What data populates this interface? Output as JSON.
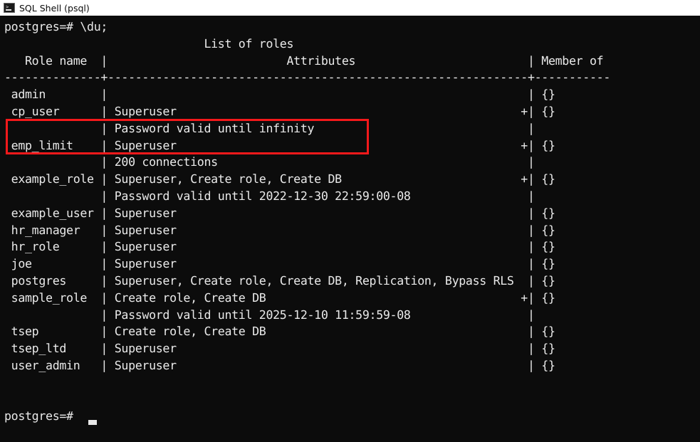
{
  "window": {
    "title": "SQL Shell (psql)",
    "icon": "console-icon",
    "background_color": "#0c0c0c",
    "text_color": "#e9e9e9",
    "titlebar_color": "#ffffff"
  },
  "terminal": {
    "prompt": "postgres=#",
    "command": "\\du;",
    "command_line": "postgres=# \\du;",
    "trailing_prompt": "postgres=#",
    "cursor": "_",
    "report_title": "List of roles",
    "columns": [
      "Role name",
      "Attributes",
      "Member of"
    ],
    "separator_line": "-----------+-------------------------------------------------------------+-----------",
    "rows": [
      {
        "role": "admin",
        "attributes": [
          ""
        ],
        "continued": false,
        "member_of": "{}"
      },
      {
        "role": "cp_user",
        "attributes": [
          "Superuser",
          "Password valid until infinity"
        ],
        "continued": true,
        "member_of": "{}"
      },
      {
        "role": "emp_limit",
        "attributes": [
          "Superuser",
          "200 connections"
        ],
        "continued": true,
        "member_of": "{}"
      },
      {
        "role": "example_role",
        "attributes": [
          "Superuser, Create role, Create DB",
          "Password valid until 2022-12-30 22:59:00-08"
        ],
        "continued": true,
        "member_of": "{}"
      },
      {
        "role": "example_user",
        "attributes": [
          "Superuser"
        ],
        "continued": false,
        "member_of": "{}"
      },
      {
        "role": "hr_manager",
        "attributes": [
          "Superuser"
        ],
        "continued": false,
        "member_of": "{}"
      },
      {
        "role": "hr_role",
        "attributes": [
          "Superuser"
        ],
        "continued": false,
        "member_of": "{}"
      },
      {
        "role": "joe",
        "attributes": [
          "Superuser"
        ],
        "continued": false,
        "member_of": "{}"
      },
      {
        "role": "postgres",
        "attributes": [
          "Superuser, Create role, Create DB, Replication, Bypass RLS"
        ],
        "continued": false,
        "member_of": "{}"
      },
      {
        "role": "sample_role",
        "attributes": [
          "Create role, Create DB",
          "Password valid until 2025-12-10 11:59:59-08"
        ],
        "continued": true,
        "member_of": "{}"
      },
      {
        "role": "tsep",
        "attributes": [
          "Create role, Create DB"
        ],
        "continued": false,
        "member_of": "{}"
      },
      {
        "role": "tsep_ltd",
        "attributes": [
          "Superuser"
        ],
        "continued": false,
        "member_of": "{}"
      },
      {
        "role": "user_admin",
        "attributes": [
          "Superuser"
        ],
        "continued": false,
        "member_of": "{}"
      }
    ],
    "screen_text": "postgres=# \\du;\n                             List of roles\n   Role name  |                          Attributes                         | Member of\n--------------+-------------------------------------------------------------+-----------\n admin        |                                                             | {}\n cp_user      | Superuser                                                  +| {}\n              | Password valid until infinity                               |\n emp_limit    | Superuser                                                  +| {}\n              | 200 connections                                             |\n example_role | Superuser, Create role, Create DB                          +| {}\n              | Password valid until 2022-12-30 22:59:00-08                 |\n example_user | Superuser                                                   | {}\n hr_manager   | Superuser                                                   | {}\n hr_role      | Superuser                                                   | {}\n joe          | Superuser                                                   | {}\n postgres     | Superuser, Create role, Create DB, Replication, Bypass RLS  | {}\n sample_role  | Create role, Create DB                                     +| {}\n              | Password valid until 2025-12-10 11:59:59-08                 |\n tsep         | Create role, Create DB                                      | {}\n tsep_ltd     | Superuser                                                   | {}\n user_admin   | Superuser                                                   | {}\n\n\npostgres=#"
  },
  "annotation": {
    "type": "rectangle-highlight",
    "color": "#f5191b",
    "target_role": "cp_user",
    "covers": [
      "cp_user  | Superuser",
      "         | Password valid until infinity"
    ]
  }
}
